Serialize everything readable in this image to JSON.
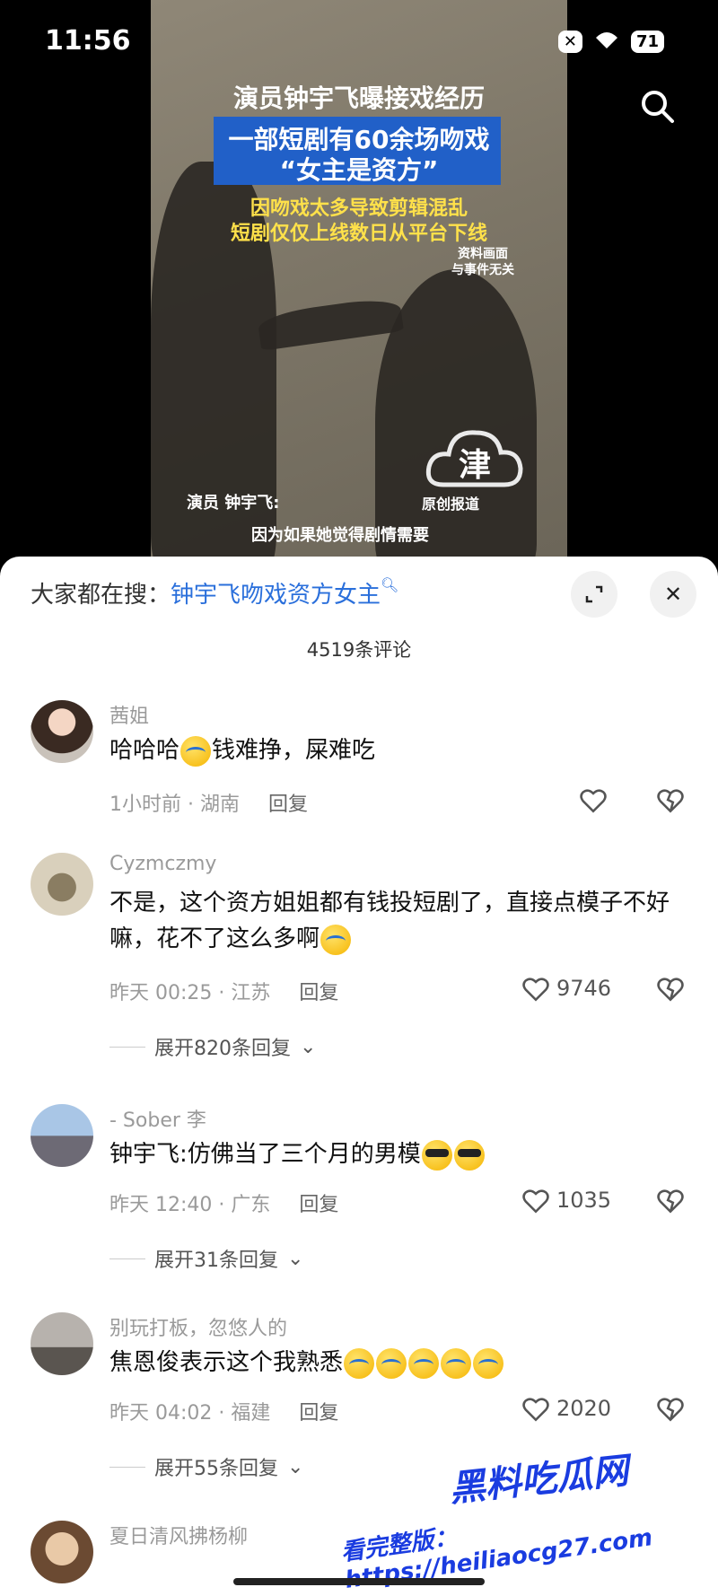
{
  "status_bar": {
    "time": "11:56",
    "battery": "71"
  },
  "video": {
    "caption_title": "演员钟宇飞曝接戏经历",
    "caption_line1": "一部短剧有60余场吻戏",
    "caption_line2": "“女主是资方”",
    "caption_yellow1": "因吻戏太多导致剪辑混乱",
    "caption_yellow2": "短剧仅仅上线数日从平台下线",
    "disclaimer1": "资料画面",
    "disclaimer2": "与事件无关",
    "logo_char": "津",
    "logo_text": "原创报道",
    "subtitle_speaker": "演员 钟宇飞:",
    "subtitle_text": "因为如果她觉得剧情需要"
  },
  "comments_panel": {
    "hot_search_label": "大家都在搜：",
    "hot_search_keyword": "钟宇飞吻戏资方女主",
    "count_label": "4519条评论",
    "reply_label": "回复",
    "comments": [
      {
        "username": "茜姐",
        "text_before": "哈哈哈",
        "text_after": "钱难挣，屎难吃",
        "time": "1小时前 · 湖南",
        "likes": ""
      },
      {
        "username": "Cyzmczmy",
        "text": "不是，这个资方姐姐都有钱投短剧了，直接点模子不好嘛，花不了这么多啊",
        "time": "昨天 00:25 · 江苏",
        "likes": "9746",
        "expand": "展开820条回复"
      },
      {
        "username": "- Sober 李",
        "text": "钟宇飞:仿佛当了三个月的男模",
        "time": "昨天 12:40 · 广东",
        "likes": "1035",
        "expand": "展开31条回复"
      },
      {
        "username": "别玩打板，忽悠人的",
        "text": "焦恩俊表示这个我熟悉",
        "time": "昨天 04:02 · 福建",
        "likes": "2020",
        "expand": "展开55条回复"
      },
      {
        "username": "夏日清风拂杨柳",
        "text": ""
      }
    ]
  },
  "overlay": {
    "site_mark": "黑料吃瓜网",
    "site_url": "看完整版：https://heiliaocg27.com"
  },
  "colors": {
    "accent": "#2a6fdb",
    "caption_box": "#2160c8",
    "caption_yellow": "#ffe14a"
  }
}
